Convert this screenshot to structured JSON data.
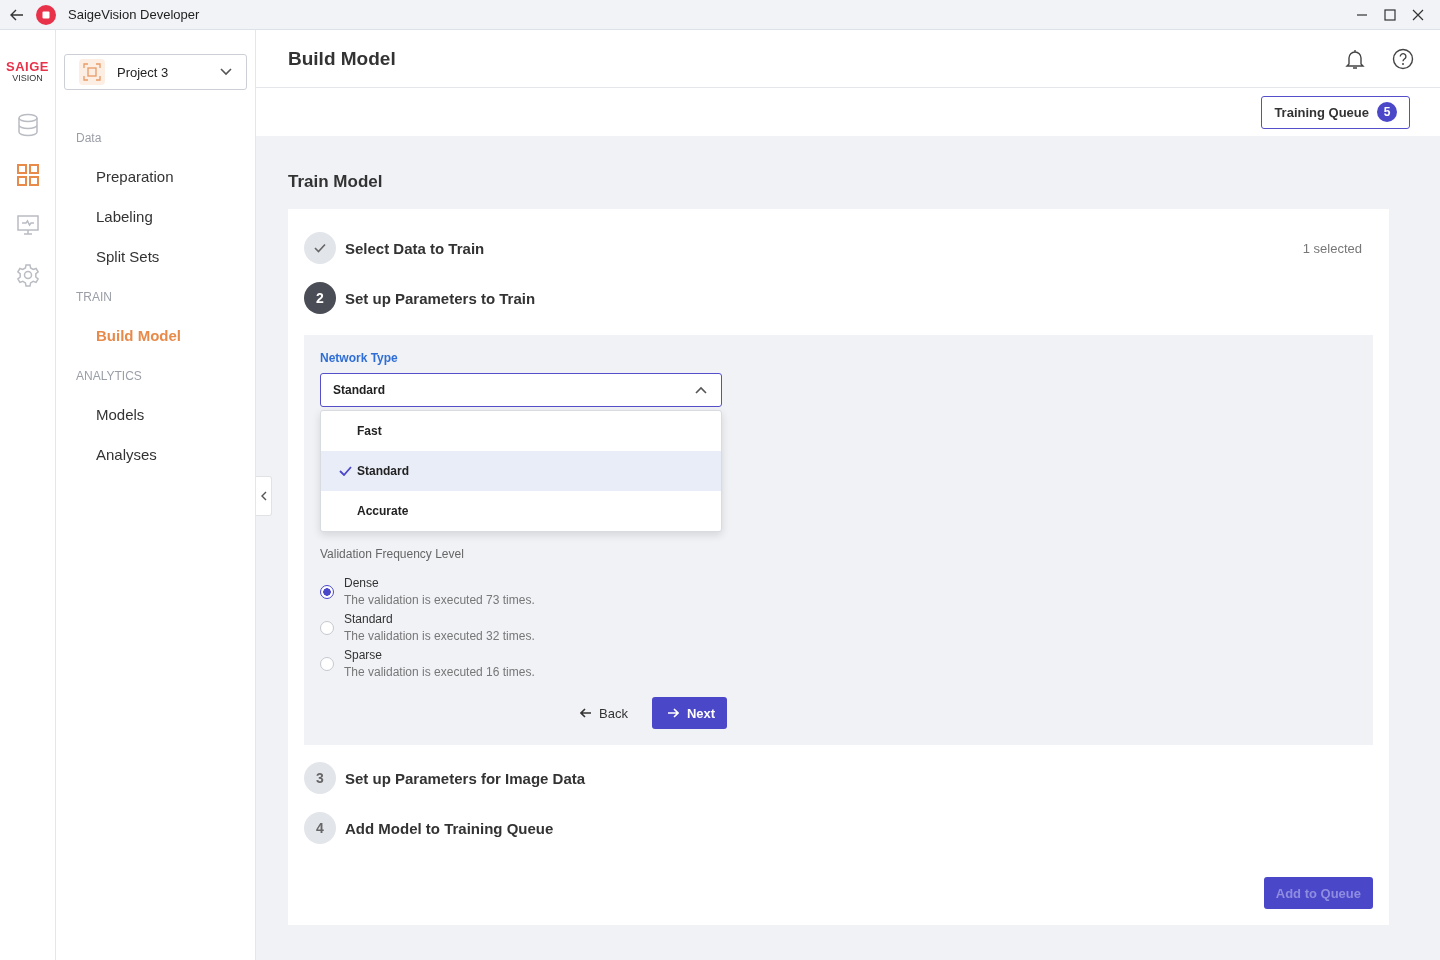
{
  "window": {
    "title": "SaigeVision Developer"
  },
  "logo": {
    "line_1": "SAIGE",
    "line_2": "VISION"
  },
  "rail": [
    {
      "kind": "database",
      "selected": false
    },
    {
      "kind": "apps",
      "selected": true
    },
    {
      "kind": "monitor",
      "selected": false
    },
    {
      "kind": "settings",
      "selected": false
    }
  ],
  "project": {
    "name": "Project 3"
  },
  "sidebar": [
    {
      "heading": "Data",
      "items": [
        {
          "label": "Preparation",
          "selected": false
        },
        {
          "label": "Labeling",
          "selected": false
        },
        {
          "label": "Split Sets",
          "selected": false
        }
      ]
    },
    {
      "heading": "TRAIN",
      "items": [
        {
          "label": "Build Model",
          "selected": true
        }
      ]
    },
    {
      "heading": "ANALYTICS",
      "items": [
        {
          "label": "Models",
          "selected": false
        },
        {
          "label": "Analyses",
          "selected": false
        }
      ]
    }
  ],
  "page_title": "Build Model",
  "training_queue": {
    "label": "Training Queue",
    "count": "5"
  },
  "section_title": "Train Model",
  "steps": [
    {
      "kind": "done",
      "title": "Select Data to Train",
      "note": "1 selected"
    },
    {
      "kind": "current",
      "number": "2",
      "title": "Set up Parameters to Train"
    },
    {
      "kind": "pending",
      "number": "3",
      "title": "Set up Parameters for Image Data"
    },
    {
      "kind": "pending",
      "number": "4",
      "title": "Add Model to Training Queue"
    }
  ],
  "network_type": {
    "label": "Network Type",
    "value": "Standard",
    "expanded": true,
    "options": [
      {
        "label": "Fast",
        "selected": false
      },
      {
        "label": "Standard",
        "selected": true
      },
      {
        "label": "Accurate",
        "selected": false
      }
    ]
  },
  "validation": {
    "label": "Validation Frequency Level",
    "options": [
      {
        "label": "Dense",
        "description": "The validation is executed 73 times.",
        "selected": true
      },
      {
        "label": "Standard",
        "description": "The validation is executed 32 times.",
        "selected": false
      },
      {
        "label": "Sparse",
        "description": "The validation is executed 16 times.",
        "selected": false
      }
    ]
  },
  "back_button": "Back",
  "next_button": "Next",
  "add_button": {
    "label": "Add to Queue",
    "disabled": true
  }
}
